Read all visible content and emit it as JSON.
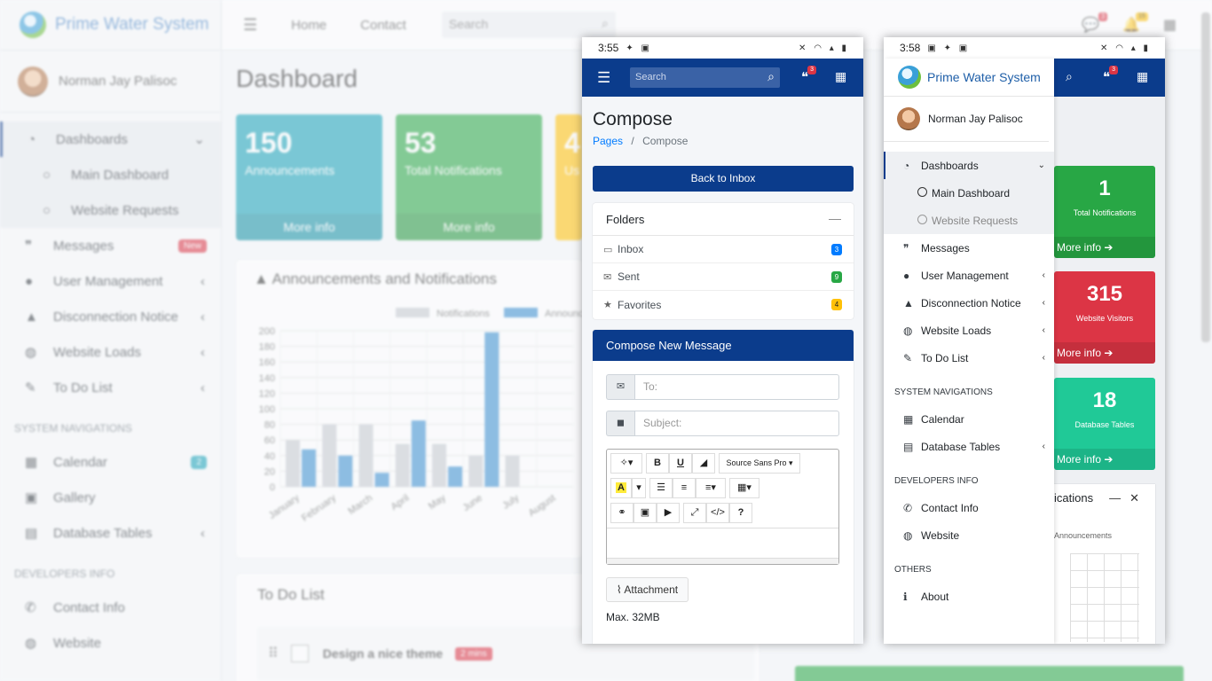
{
  "background": {
    "brand": "Prime Water System",
    "user_name": "Norman Jay Palisoc",
    "topbar": {
      "home": "Home",
      "contact": "Contact",
      "search_placeholder": "Search",
      "chat_count": "3",
      "notif_count": "15"
    },
    "page_title": "Dashboard",
    "sidebar": {
      "dashboards": "Dashboards",
      "main_dashboard": "Main Dashboard",
      "website_requests": "Website Requests",
      "messages": "Messages",
      "messages_badge": "New",
      "user_management": "User Management",
      "disconnection_notice": "Disconnection Notice",
      "website_loads": "Website Loads",
      "todo": "To Do List",
      "sys_nav_header": "SYSTEM NAVIGATIONS",
      "calendar": "Calendar",
      "calendar_badge": "2",
      "gallery": "Gallery",
      "database_tables": "Database Tables",
      "dev_header": "DEVELOPERS INFO",
      "contact_info": "Contact Info",
      "website": "Website"
    },
    "stats": [
      {
        "num": "150",
        "label": "Announcements",
        "more": "More info",
        "color": "#17a2b8"
      },
      {
        "num": "53",
        "label": "Total Notifications",
        "more": "More info",
        "color": "#28a745"
      },
      {
        "num": "4",
        "label": "Us",
        "more": "",
        "color": "#ffc107"
      }
    ],
    "chart_card_title": "Announcements and Notifications",
    "todo_title": "To Do List",
    "todo_item": "Design a nice theme",
    "todo_badge": "2 mins"
  },
  "chart_data": {
    "type": "bar",
    "title": "",
    "categories": [
      "January",
      "February",
      "March",
      "April",
      "May",
      "June",
      "July",
      "August"
    ],
    "series": [
      {
        "name": "Notifications",
        "values": [
          60,
          80,
          80,
          55,
          55,
          40,
          40,
          0
        ]
      },
      {
        "name": "Announcements",
        "values": [
          48,
          40,
          18,
          85,
          26,
          198,
          0,
          0
        ]
      }
    ],
    "y_ticks": [
      "200",
      "180",
      "160",
      "140",
      "120",
      "100",
      "80",
      "60",
      "40",
      "20",
      "0"
    ],
    "ylim": [
      0,
      200
    ],
    "legend_position": "top",
    "colors": [
      "#c7cbd1",
      "#3a8fd1"
    ]
  },
  "phone1": {
    "time": "3:55",
    "search_placeholder": "Search",
    "chat_badge": "3",
    "title": "Compose",
    "breadcrumb": {
      "pages": "Pages",
      "sep": "/",
      "current": "Compose"
    },
    "back_button": "Back to Inbox",
    "folders": {
      "title": "Folders",
      "items": [
        {
          "label": "Inbox",
          "count": "3",
          "color": "#007bff"
        },
        {
          "label": "Sent",
          "count": "9",
          "color": "#28a745"
        },
        {
          "label": "Favorites",
          "count": "4",
          "color": "#ffc107"
        }
      ]
    },
    "compose": {
      "title": "Compose New Message",
      "to_placeholder": "To:",
      "subject_placeholder": "Subject:",
      "font_select": "Source Sans Pro",
      "attachment": "Attachment",
      "max_size": "Max. 32MB"
    }
  },
  "phone2": {
    "time": "3:58",
    "brand": "Prime Water System",
    "user_name": "Norman Jay Palisoc",
    "chat_badge": "3",
    "nav": {
      "dashboards": "Dashboards",
      "main_dashboard": "Main Dashboard",
      "website_requests": "Website Requests",
      "messages": "Messages",
      "user_management": "User Management",
      "disconnection_notice": "Disconnection Notice",
      "website_loads": "Website Loads",
      "todo": "To Do List",
      "sys_header": "SYSTEM NAVIGATIONS",
      "calendar": "Calendar",
      "database_tables": "Database Tables",
      "dev_header": "DEVELOPERS INFO",
      "contact_info": "Contact Info",
      "website": "Website",
      "others_header": "OTHERS",
      "about": "About"
    },
    "boxes": [
      {
        "num": "1",
        "label": "Total Notifications",
        "more": "More info",
        "color": "#28a745"
      },
      {
        "num": "315",
        "label": "Website Visitors",
        "more": "More info",
        "color": "#dc3545"
      },
      {
        "num": "18",
        "label": "Database Tables",
        "more": "More info",
        "color": "#20c997"
      }
    ],
    "card_title": "ications",
    "card_legend": "Announcements"
  }
}
